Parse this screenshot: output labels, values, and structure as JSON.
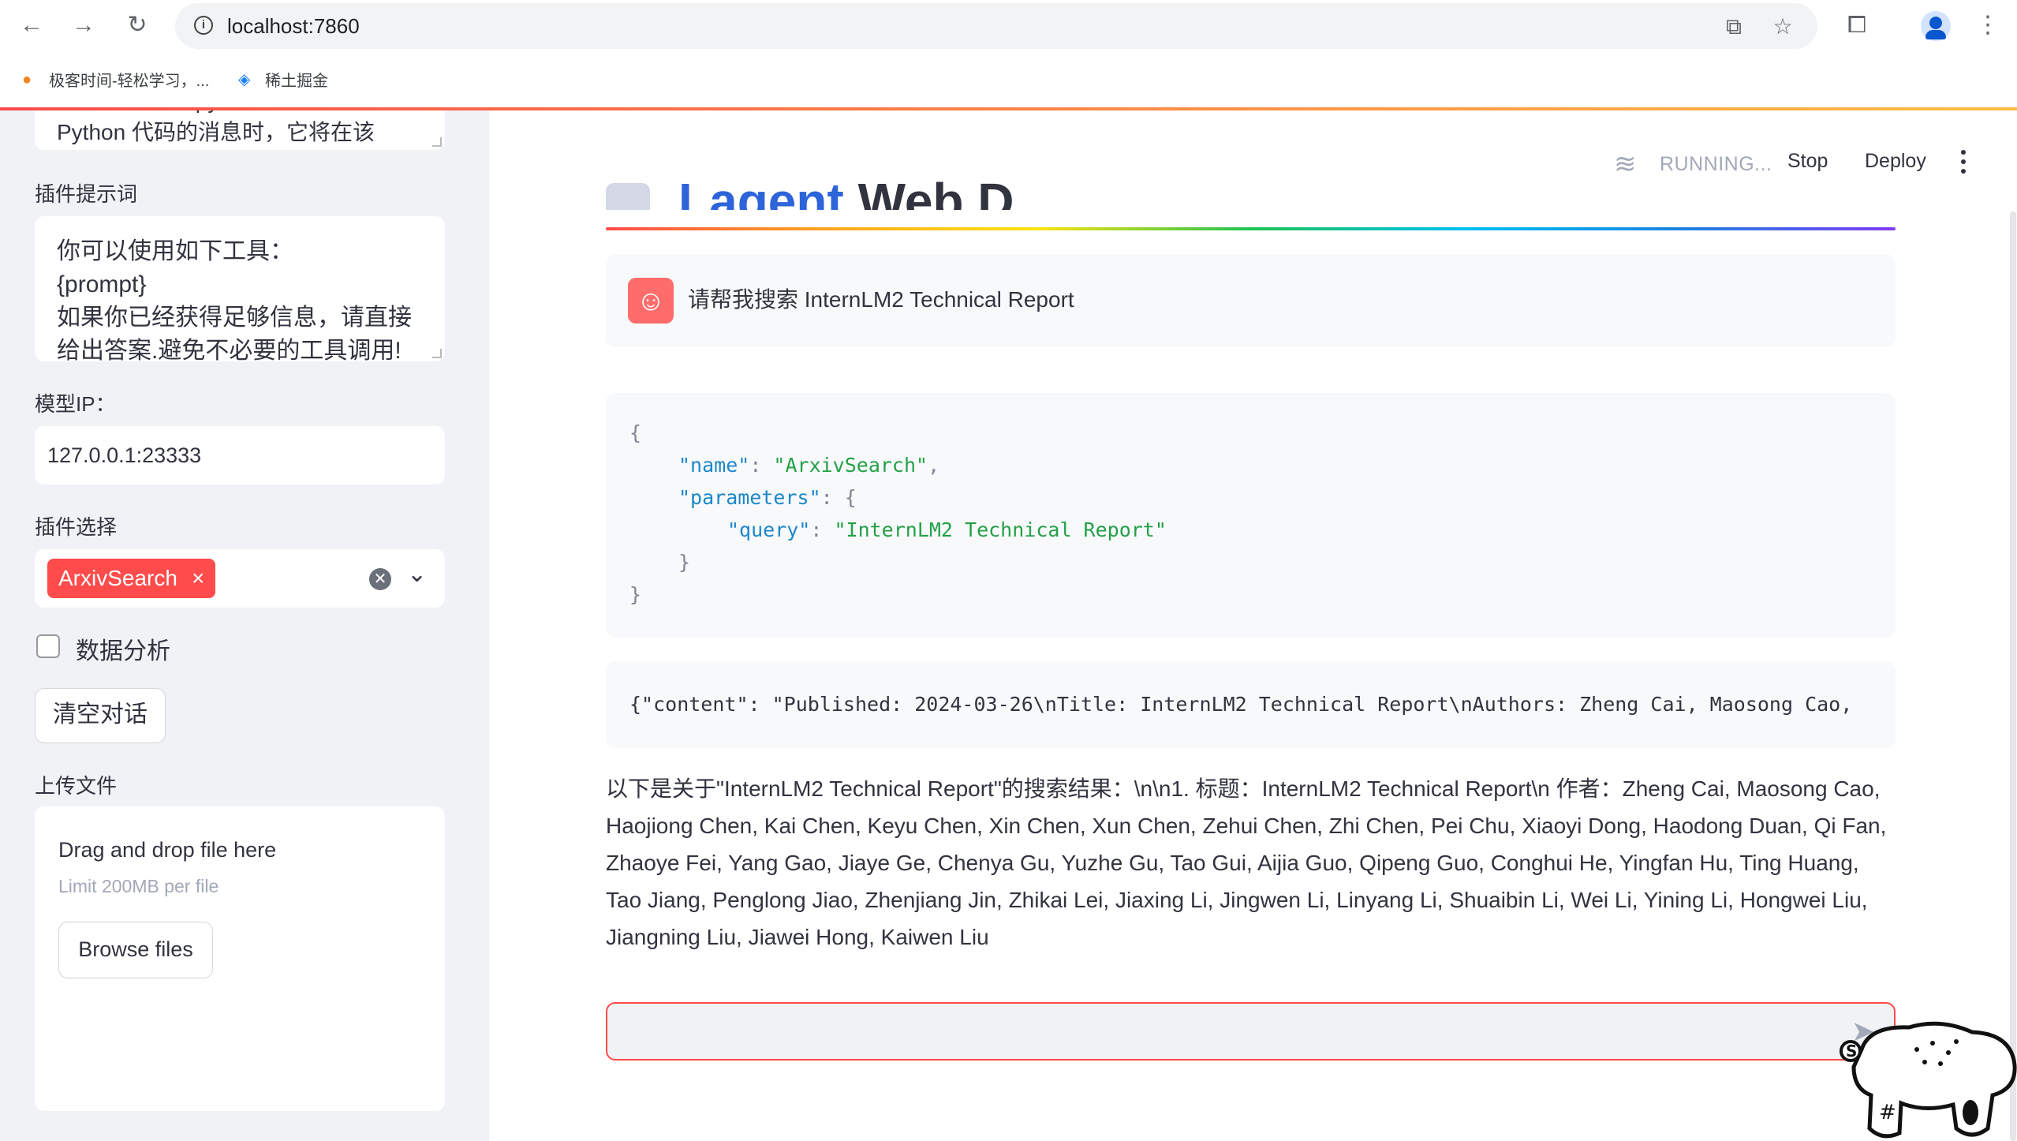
{
  "browser": {
    "url": "localhost:7860",
    "bookmarks": [
      {
        "label": "极客时间-轻松学习，..."
      },
      {
        "label": "稀土掘金"
      }
    ]
  },
  "sidebar": {
    "system_prompt_partial": "代码。当你向 python 发送含有\nPython 代码的消息时，它将在该",
    "plugin_prompt_label": "插件提示词",
    "plugin_prompt_value": "你可以使用如下工具：\n{prompt}\n如果你已经获得足够信息，请直接\n给出答案.避免不必要的工具调用!",
    "model_ip_label": "模型IP：",
    "model_ip_value": "127.0.0.1:23333",
    "plugin_select_label": "插件选择",
    "plugin_selected": "ArxivSearch",
    "tag_remove": "×",
    "data_analysis_label": "数据分析",
    "data_analysis_checked": false,
    "clear_button": "清空对话",
    "upload_label": "上传文件",
    "upload_drag_text": "Drag and drop file here",
    "upload_limit": "Limit 200MB per file",
    "browse_button": "Browse files"
  },
  "header": {
    "status": "RUNNING...",
    "stop": "Stop",
    "deploy": "Deploy"
  },
  "main": {
    "title_part1": "Lagent",
    "title_part2": "Web Demo",
    "user_message": "请帮我搜索 InternLM2 Technical Report",
    "tool_call": {
      "open": "{",
      "name_key": "\"name\"",
      "name_val": "\"ArxivSearch\"",
      "params_key": "\"parameters\"",
      "params_open": "{",
      "query_key": "\"query\"",
      "query_val": "\"InternLM2 Technical Report\"",
      "params_close": "}",
      "close": "}"
    },
    "tool_result": "{\"content\": \"Published: 2024-03-26\\nTitle: InternLM2 Technical Report\\nAuthors: Zheng Cai, Maosong Cao,",
    "answer": "以下是关于\"InternLM2 Technical Report\"的搜索结果：\\n\\n1. 标题：InternLM2 Technical Report\\n 作者：Zheng Cai, Maosong Cao, Haojiong Chen, Kai Chen, Keyu Chen, Xin Chen, Xun Chen, Zehui Chen, Zhi Chen, Pei Chu, Xiaoyi Dong, Haodong Duan, Qi Fan, Zhaoye Fei, Yang Gao, Jiaye Ge, Chenya Gu, Yuzhe Gu, Tao Gui, Aijia Guo, Qipeng Guo, Conghui He, Yingfan Hu, Ting Huang, Tao Jiang, Penglong Jiao, Zhenjiang Jin, Zhikai Lei, Jiaxing Li, Jingwen Li, Linyang Li, Shuaibin Li, Wei Li, Yining Li, Hongwei Liu, Jiangning Liu, Jiawei Hong, Kaiwen Liu",
    "chat_input_value": ""
  },
  "colors": {
    "accent": "#ff4b4b",
    "sidebar_bg": "#f0f2f6",
    "title_blue": "#2e64d9"
  }
}
